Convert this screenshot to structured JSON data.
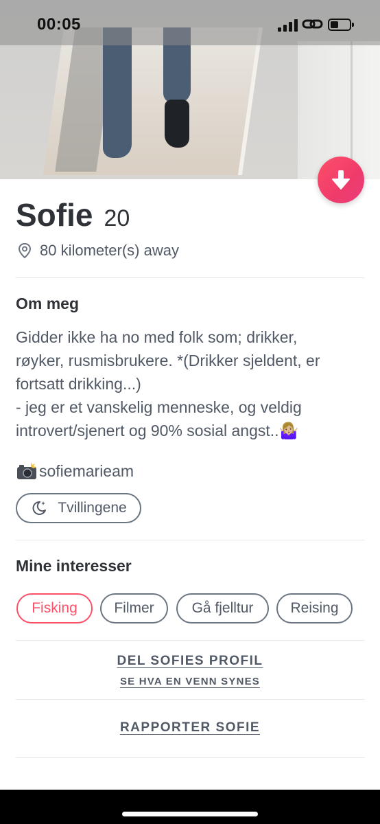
{
  "status_bar": {
    "time": "00:05"
  },
  "profile": {
    "name": "Sofie",
    "age": "20",
    "distance": "80 kilometer(s) away"
  },
  "about": {
    "title": "Om meg",
    "lines": [
      "Gidder ikke ha no med folk som; drikker,",
      "røyker, rusmisbrukere. *(Drikker sjeldent, er",
      "fortsatt drikking...)",
      "- jeg er et vanskelig menneske, og veldig",
      "introvert/sjenert og 90% sosial angst..🤷🏼‍♀️"
    ]
  },
  "instagram": {
    "handle": "sofiemarieam"
  },
  "zodiac": {
    "label": "Tvillingene"
  },
  "interests": {
    "title": "Mine interesser",
    "items": [
      "Fisking",
      "Filmer",
      "Gå fjelltur",
      "Reising"
    ]
  },
  "share": {
    "label": "DEL SOFIES PROFIL",
    "sublabel": "SE HVA EN VENN SYNES"
  },
  "report": {
    "label": "RAPPORTER SOFIE"
  },
  "colors": {
    "accent": "#fd5068",
    "text_primary": "#2f3338",
    "text_secondary": "#505965"
  }
}
